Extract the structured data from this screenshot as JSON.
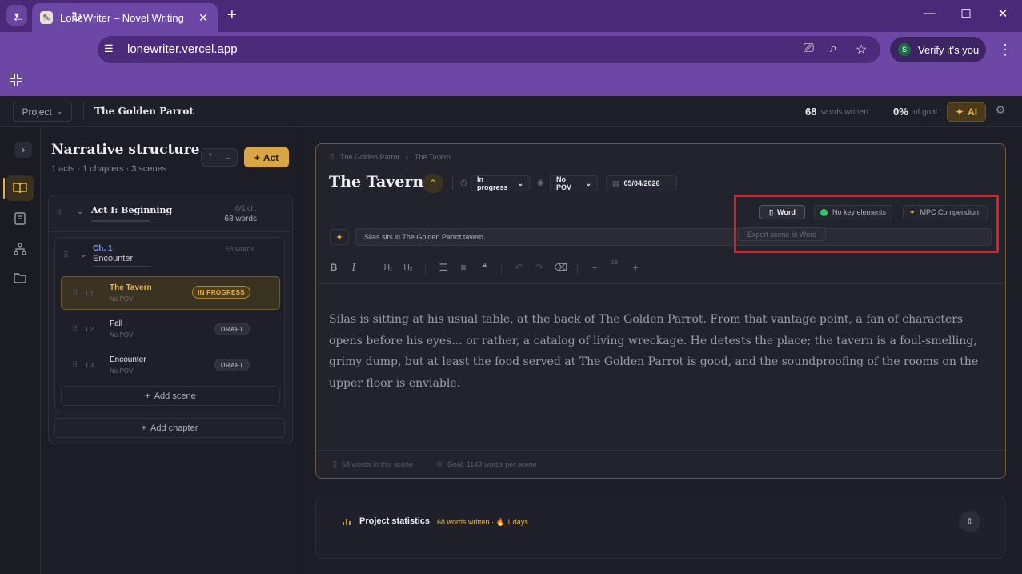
{
  "browser": {
    "tab_title": "LoneWriter – Novel Writing",
    "tab_close": "✕",
    "new_tab": "+",
    "url": "lonewriter.vercel.app",
    "verify_label": "Verify it's you",
    "avatar_letter": "S"
  },
  "header": {
    "project_label": "Project",
    "project_title": "The Golden Parrot",
    "words_count": "68",
    "words_label": "words written",
    "goal_pct": "0%",
    "goal_label": "of goal",
    "ai_label": "AI"
  },
  "structure": {
    "title": "Narrative structure",
    "subtitle": "1 acts · 1 chapters · 3 scenes",
    "add_act_label": "Act",
    "act": {
      "name": "Act I: Beginning",
      "chapters_meta": "0/1 ch.",
      "words_meta": "68 words"
    },
    "chapter": {
      "number": "Ch. 1",
      "name": "Encounter",
      "words": "68 words"
    },
    "scenes": [
      {
        "index": "1.1",
        "name": "The Tavern",
        "pov": "No POV",
        "status": "IN PROGRESS"
      },
      {
        "index": "1.2",
        "name": "Fall",
        "pov": "No POV",
        "status": "DRAFT"
      },
      {
        "index": "1.3",
        "name": "Encounter",
        "pov": "No POV",
        "status": "DRAFT"
      }
    ],
    "add_scene_label": "Add scene",
    "add_chapter_label": "Add chapter"
  },
  "editor": {
    "breadcrumb": [
      "The Golden Parrot",
      "The Tavern"
    ],
    "title": "The Tavern",
    "status_value": "In progress",
    "pov_value": "No POV",
    "date_value": "05/04/2026",
    "word_export_label": "Word",
    "key_elements_label": "No key elements",
    "compendium_label": "MPC Compendium",
    "export_tooltip": "Export scene to Word",
    "summary": "Silas sits in The Golden Parrot tavern.",
    "font_size": "18",
    "text": "Silas is sitting at his usual table, at the back of The Golden Parrot. From that vantage point, a fan of characters opens before his eyes... or rather, a catalog of living wreckage. He detests the place; the tavern is a foul-smelling, grimy dump, but at least the food served at The Golden Parrot is good, and the soundproofing of the rooms on the upper floor is enviable.",
    "footer_words": "68 words in this scene",
    "footer_goal": "Goal: 1143 words per scene"
  },
  "stats": {
    "title": "Project statistics",
    "words_written": "68 words written",
    "separator": "·",
    "days": "1 days"
  },
  "colors": {
    "accent": "#e7b54a",
    "browser_purple": "#6d47a6",
    "highlight_red": "#e11d2a",
    "status_green": "#37c46a"
  }
}
